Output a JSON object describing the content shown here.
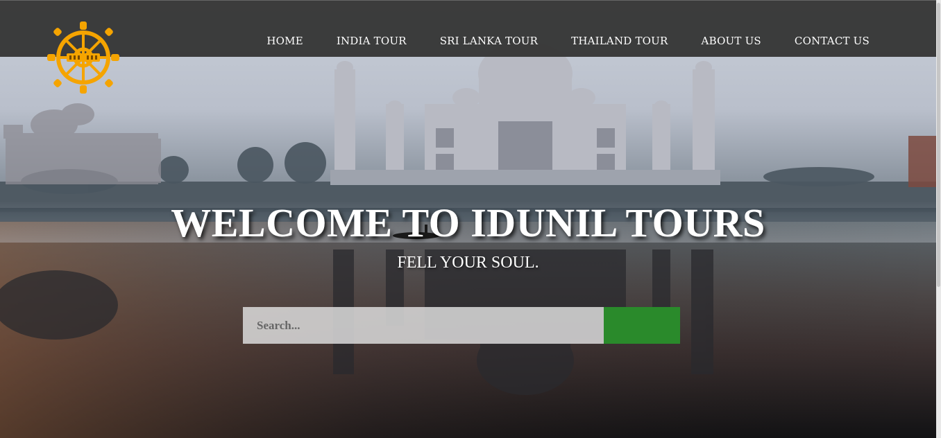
{
  "nav": {
    "items": [
      {
        "label": "HOME"
      },
      {
        "label": "INDIA TOUR"
      },
      {
        "label": "SRI LANKA TOUR"
      },
      {
        "label": "THAILAND TOUR"
      },
      {
        "label": "ABOUT US"
      },
      {
        "label": "CONTACT US"
      }
    ]
  },
  "hero": {
    "title_part1": "WELCOME TO ",
    "title_part2": "IDUNIL TOURS",
    "subtitle": "FELL YOUR SOUL."
  },
  "search": {
    "placeholder": "Search...",
    "value": "",
    "button_label": ""
  },
  "colors": {
    "nav_bg": "#373737",
    "logo": "#f5a400",
    "search_button": "#2a8a2b"
  },
  "icons": {
    "logo": "dharma-wheel-icon"
  }
}
